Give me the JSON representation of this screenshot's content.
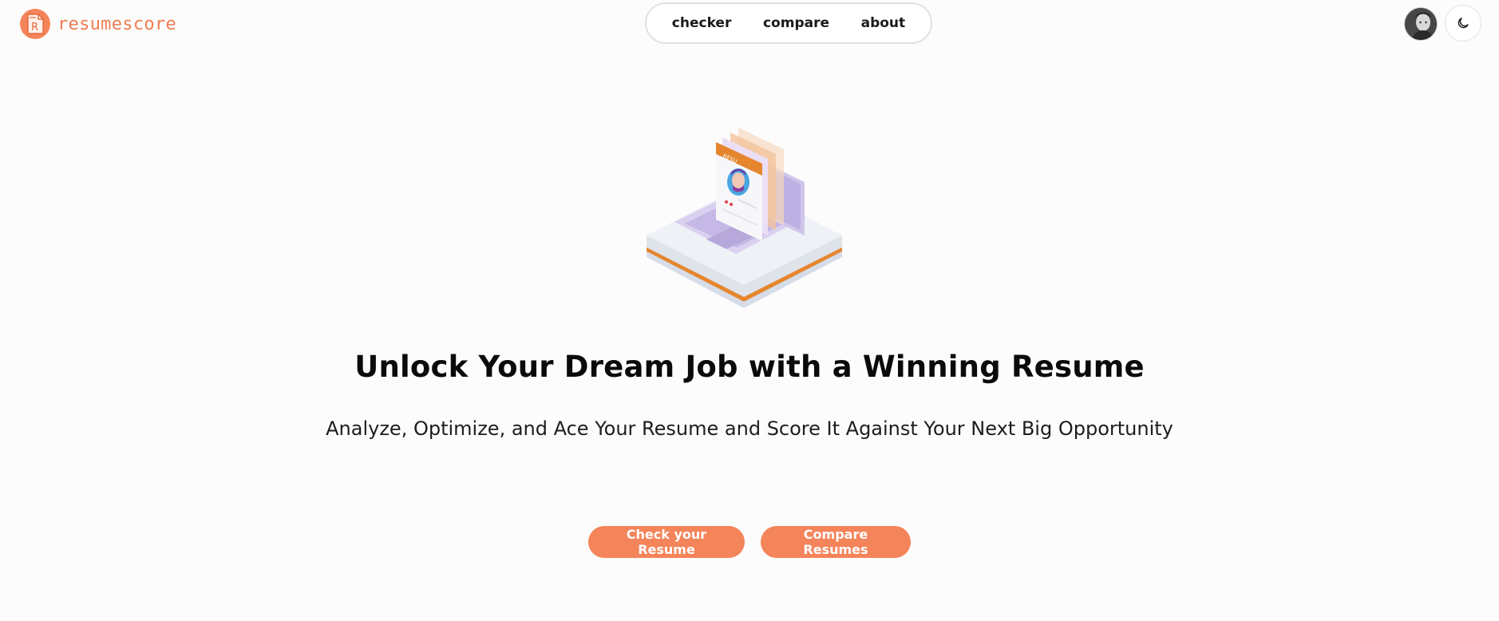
{
  "brand": {
    "name": "resumescore",
    "logo_icon": "resume-logo-icon",
    "color": "#ef7d52"
  },
  "nav": {
    "items": [
      {
        "label": "checker"
      },
      {
        "label": "compare"
      },
      {
        "label": "about"
      }
    ]
  },
  "header": {
    "avatar_icon": "user-avatar",
    "theme_toggle_icon": "moon-icon"
  },
  "hero": {
    "illustration_icon": "resume-laptop-illustration",
    "title": "Unlock Your Dream Job with a Winning Resume",
    "subtitle": "Analyze, Optimize, and Ace Your Resume and Score It Against Your Next Big Opportunity",
    "buttons": [
      {
        "label": "Check your Resume"
      },
      {
        "label": "Compare Resumes"
      }
    ],
    "accent": "#f4845a"
  }
}
